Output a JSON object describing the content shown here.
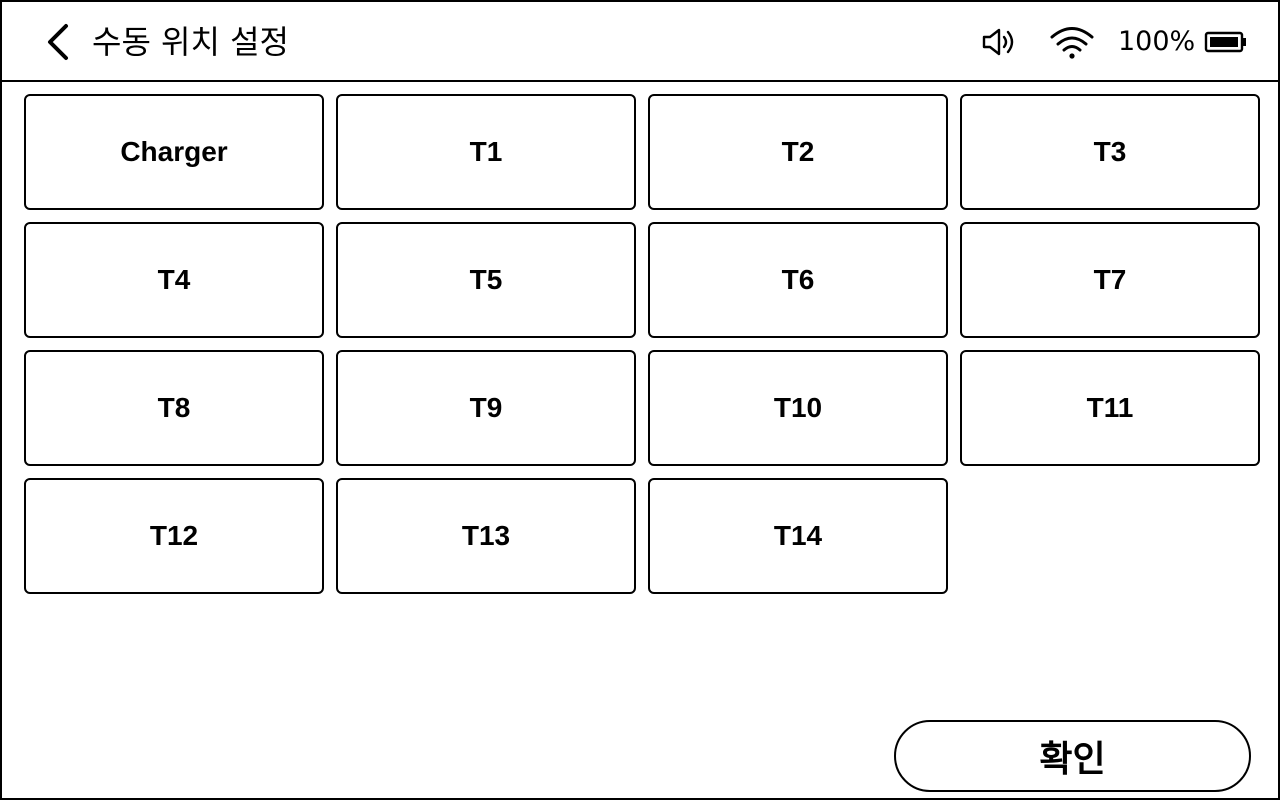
{
  "header": {
    "title": "수동 위치 설정",
    "back_icon": "chevron-left-icon",
    "volume_icon": "speaker-icon",
    "wifi_icon": "wifi-icon",
    "battery_percent_text": "100%",
    "battery_level": 1.0,
    "battery_icon": "battery-full-icon"
  },
  "locations": [
    {
      "label": "Charger"
    },
    {
      "label": "T1"
    },
    {
      "label": "T2"
    },
    {
      "label": "T3"
    },
    {
      "label": "T4"
    },
    {
      "label": "T5"
    },
    {
      "label": "T6"
    },
    {
      "label": "T7"
    },
    {
      "label": "T8"
    },
    {
      "label": "T9"
    },
    {
      "label": "T10"
    },
    {
      "label": "T11"
    },
    {
      "label": "T12"
    },
    {
      "label": "T13"
    },
    {
      "label": "T14"
    }
  ],
  "footer": {
    "confirm_label": "확인"
  },
  "colors": {
    "background": "#ffffff",
    "foreground": "#000000"
  }
}
